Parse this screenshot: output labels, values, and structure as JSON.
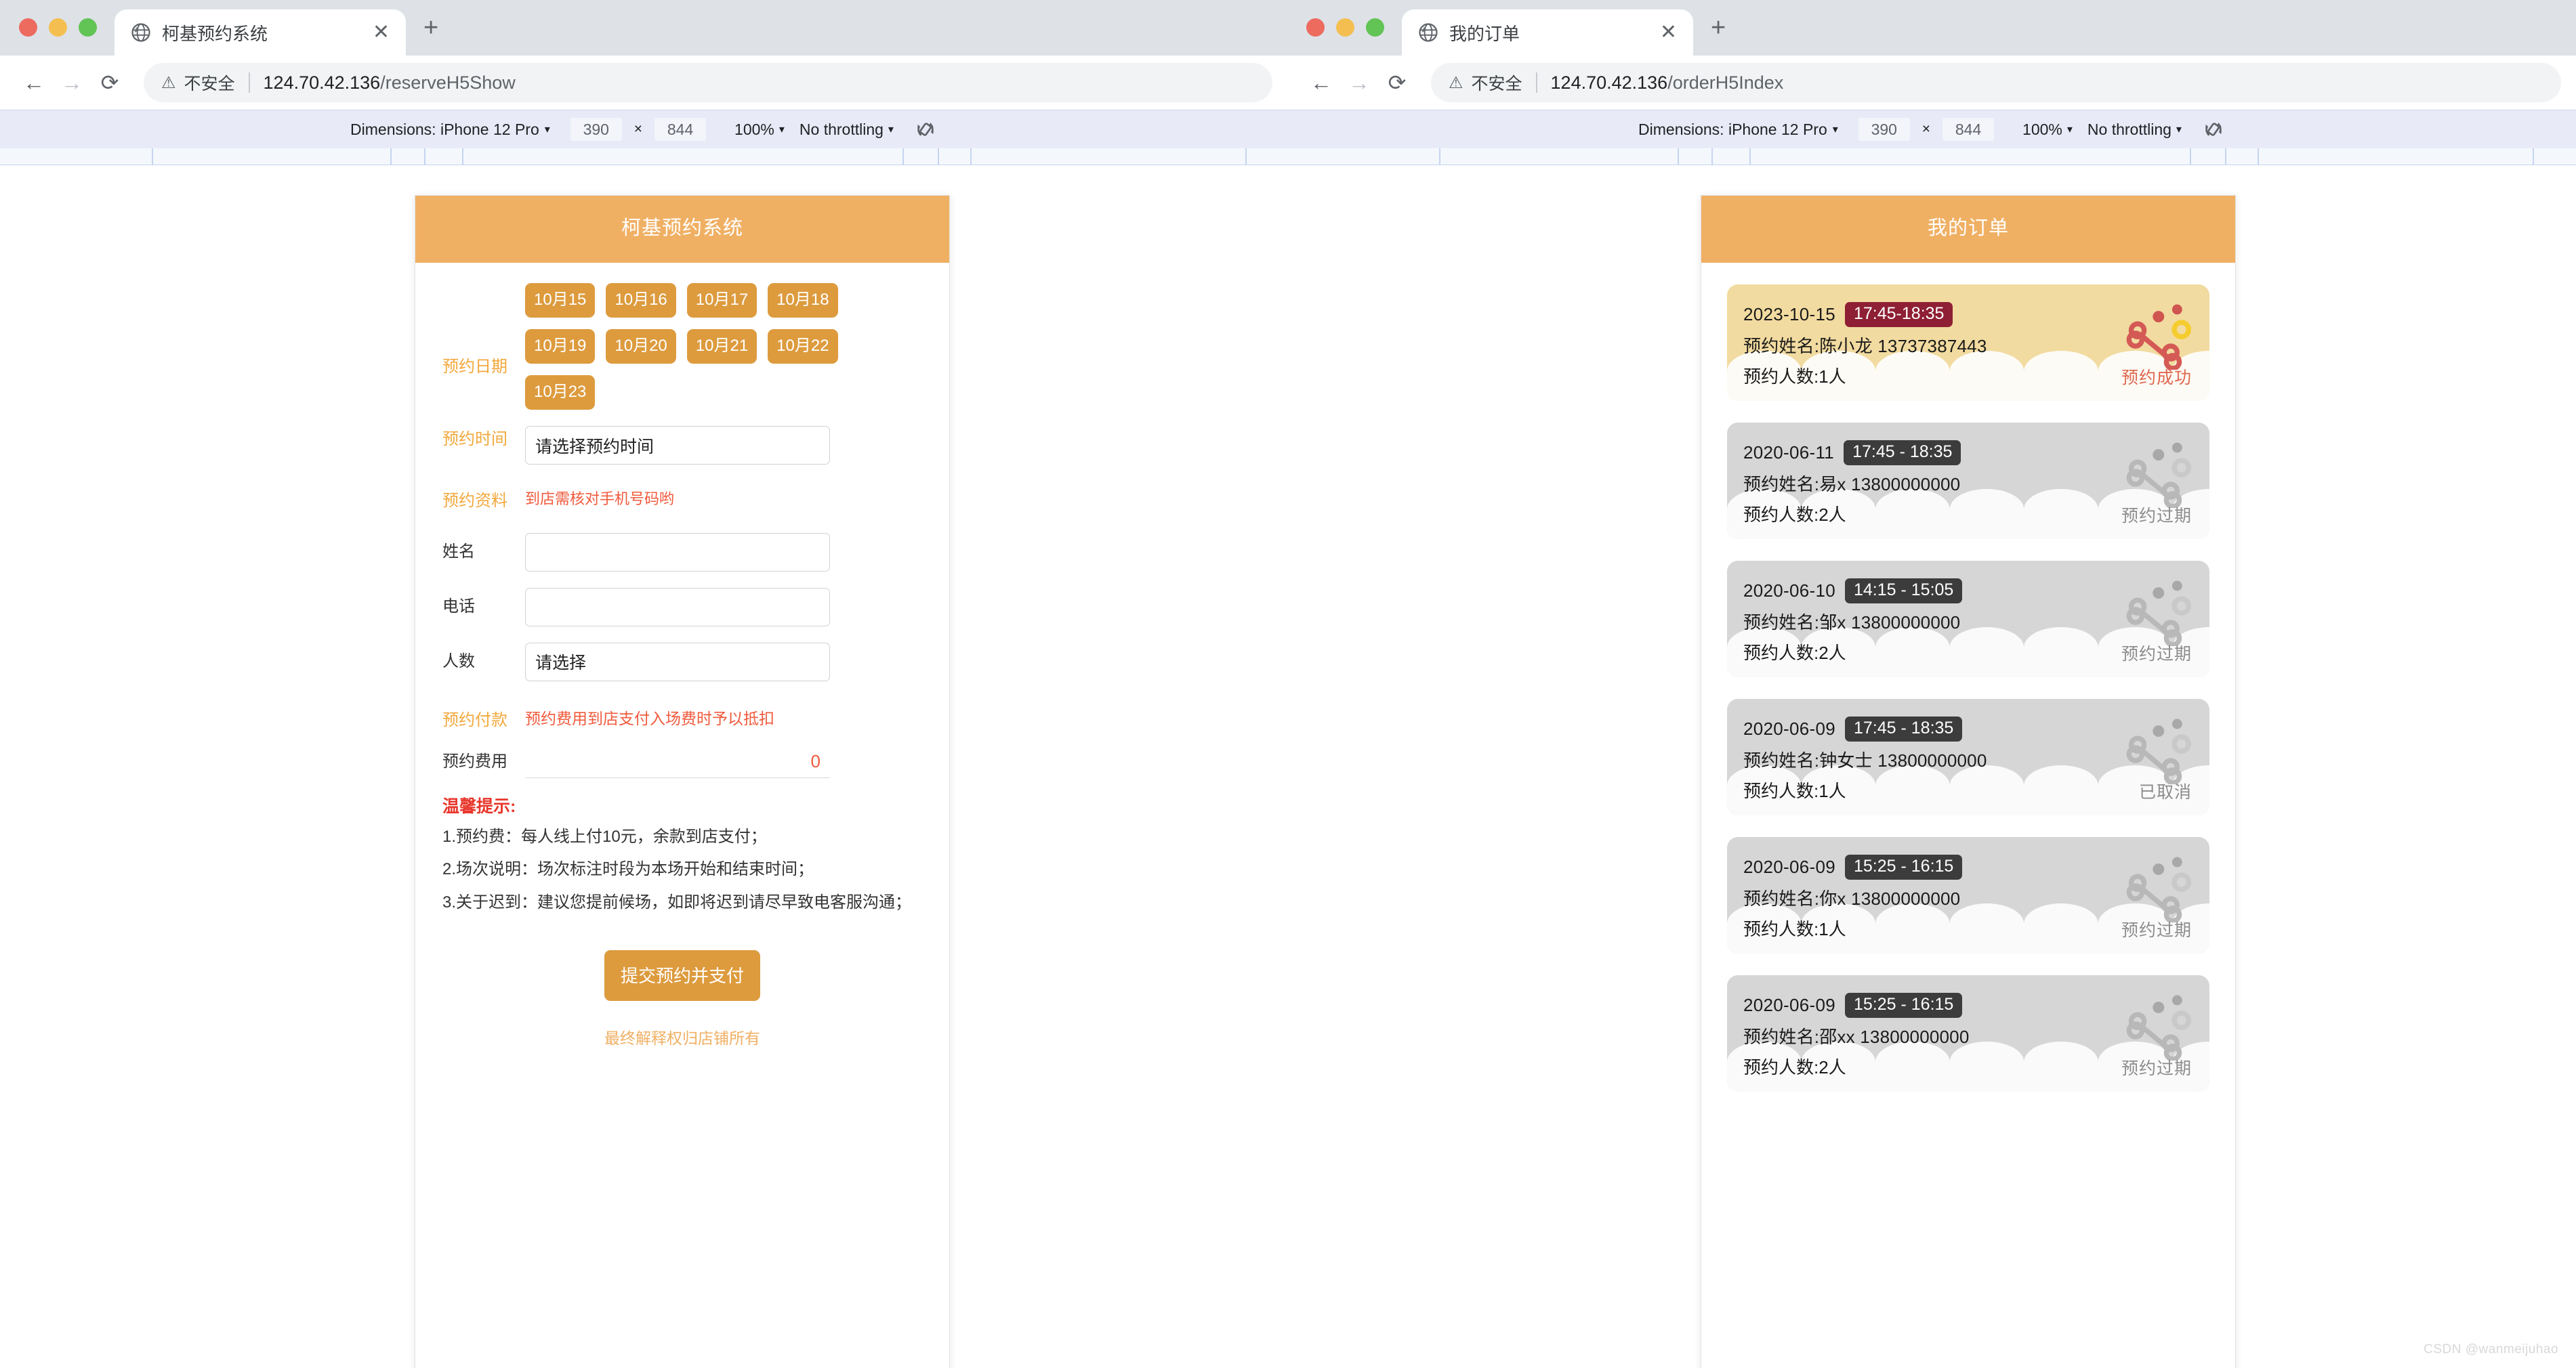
{
  "browser_left": {
    "tab": {
      "title": "柯基预约系统",
      "favicon": "globe-icon",
      "close": "✕"
    },
    "new_tab": "+",
    "nav": {
      "back": "←",
      "forward": "→",
      "reload": "⟳"
    },
    "omnibox": {
      "warn_icon": "warning-triangle-icon",
      "warn_text": "不安全",
      "url_host": "124.70.42.136",
      "url_path": "/reserveH5Show"
    },
    "devtools_bar": {
      "dimensions_label": "Dimensions: iPhone 12 Pro",
      "width": "390",
      "x": "×",
      "height": "844",
      "zoom": "100%",
      "throttling": "No throttling",
      "rotate_icon": "rotate-device-icon",
      "caret": "▾"
    }
  },
  "browser_right": {
    "tab": {
      "title": "我的订单",
      "favicon": "globe-icon",
      "close": "✕"
    },
    "new_tab": "+",
    "nav": {
      "back": "←",
      "forward": "→",
      "reload": "⟳"
    },
    "omnibox": {
      "warn_icon": "warning-triangle-icon",
      "warn_text": "不安全",
      "url_host": "124.70.42.136",
      "url_path": "/orderH5Index"
    },
    "devtools_bar": {
      "dimensions_label": "Dimensions: iPhone 12 Pro",
      "width": "390",
      "x": "×",
      "height": "844",
      "zoom": "100%",
      "throttling": "No throttling",
      "rotate_icon": "rotate-device-icon",
      "caret": "▾"
    }
  },
  "reserve_page": {
    "header_title": "柯基预约系统",
    "date_label": "预约日期",
    "dates": [
      "10月15",
      "10月16",
      "10月17",
      "10月18",
      "10月19",
      "10月20",
      "10月21",
      "10月22",
      "10月23"
    ],
    "time_label": "预约时间",
    "time_placeholder": "请选择预约时间",
    "info_label": "预约资料",
    "info_hint": "到店需核对手机号码哟",
    "name_label": "姓名",
    "name_value": "",
    "phone_label": "电话",
    "phone_value": "",
    "people_label": "人数",
    "people_placeholder": "请选择",
    "payment_label": "预约付款",
    "payment_hint": "预约费用到店支付入场费时予以抵扣",
    "fee_label": "预约费用",
    "fee_value": "0",
    "tips_title": "温馨提示:",
    "tips": [
      "1.预约费：每人线上付10元，余款到店支付；",
      "2.场次说明：场次标注时段为本场开始和结束时间；",
      "3.关于迟到：建议您提前候场，如即将迟到请尽早致电客服沟通；"
    ],
    "submit_label": "提交预约并支付",
    "footnote": "最终解释权归店铺所有"
  },
  "orders_page": {
    "header_title": "我的订单",
    "orders": [
      {
        "date": "2023-10-15",
        "time": "17:45-18:35",
        "name_line": "预约姓名:陈小龙 13737387443",
        "count_line": "预约人数:1人",
        "status": "预约成功",
        "theme": "success"
      },
      {
        "date": "2020-06-11",
        "time": "17:45 - 18:35",
        "name_line": "预约姓名:易x 13800000000",
        "count_line": "预约人数:2人",
        "status": "预约过期",
        "theme": "expired"
      },
      {
        "date": "2020-06-10",
        "time": "14:15 - 15:05",
        "name_line": "预约姓名:邹x 13800000000",
        "count_line": "预约人数:2人",
        "status": "预约过期",
        "theme": "expired"
      },
      {
        "date": "2020-06-09",
        "time": "17:45 - 18:35",
        "name_line": "预约姓名:钟女士 13800000000",
        "count_line": "预约人数:1人",
        "status": "已取消",
        "theme": "cancelled"
      },
      {
        "date": "2020-06-09",
        "time": "15:25 - 16:15",
        "name_line": "预约姓名:你x 13800000000",
        "count_line": "预约人数:1人",
        "status": "预约过期",
        "theme": "expired"
      },
      {
        "date": "2020-06-09",
        "time": "15:25 - 16:15",
        "name_line": "预约姓名:邵xx 13800000000",
        "count_line": "预约人数:2人",
        "status": "预约过期",
        "theme": "expired"
      }
    ]
  },
  "watermark": "CSDN @wanmeijuhao",
  "colors": {
    "brand_header": "#f0b064",
    "chip": "#dd9b3e",
    "accent_text": "#f2a83c",
    "hint_red": "#f05a3c",
    "tips_red": "#e8362b",
    "badge_success": "#8e1f34",
    "badge_expired": "#3c3c3c",
    "card_success_bg": "#f2dba0",
    "card_expired_bg": "#d6d6d6"
  }
}
